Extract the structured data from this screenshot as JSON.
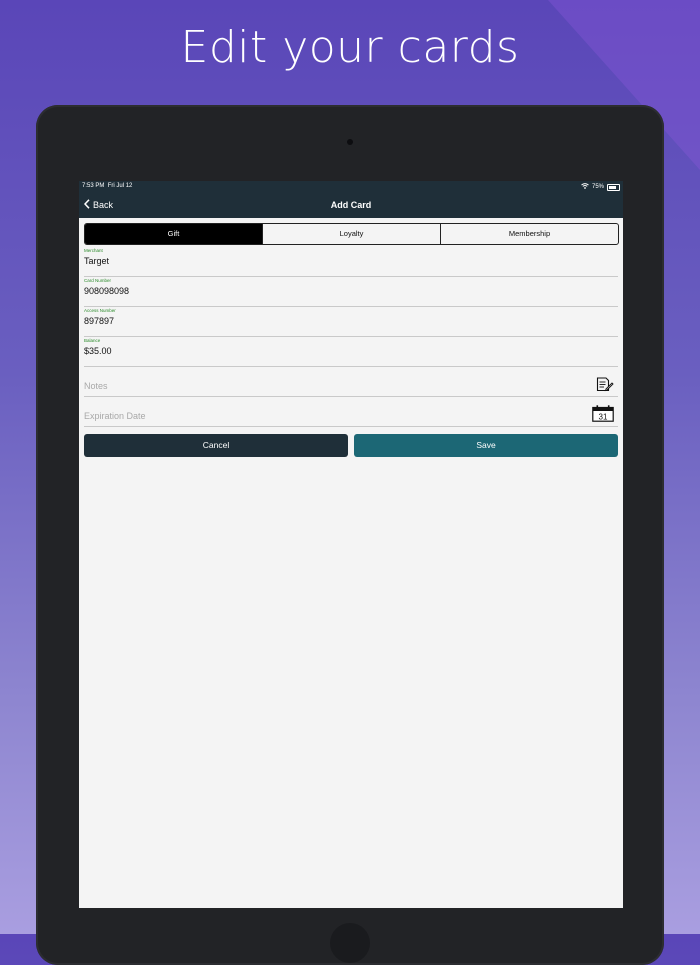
{
  "hero": {
    "title": "Edit your cards"
  },
  "status_bar": {
    "time": "7:53 PM",
    "date": "Fri Jul 12",
    "battery": "75%"
  },
  "nav": {
    "back_label": "Back",
    "title": "Add Card"
  },
  "segments": [
    {
      "label": "Gift",
      "selected": true
    },
    {
      "label": "Loyalty",
      "selected": false
    },
    {
      "label": "Membership",
      "selected": false
    }
  ],
  "form": {
    "merchant": {
      "label": "Merchant",
      "value": "Target"
    },
    "card_number": {
      "label": "Card Number",
      "value": "908098098"
    },
    "access_number": {
      "label": "Access Number",
      "value": "897897"
    },
    "balance": {
      "label": "Balance",
      "value": "$35.00"
    },
    "notes": {
      "placeholder": "Notes",
      "icon": "notes-edit-icon"
    },
    "expiration": {
      "placeholder": "Expiration Date",
      "icon": "calendar-icon",
      "icon_text": "31"
    }
  },
  "buttons": {
    "cancel": "Cancel",
    "save": "Save"
  },
  "colors": {
    "navbar": "#1f2f39",
    "cancel_button": "#1f2f39",
    "save_button": "#1c6775",
    "field_label": "#2a8a2a",
    "segment_selected": "#000000"
  }
}
